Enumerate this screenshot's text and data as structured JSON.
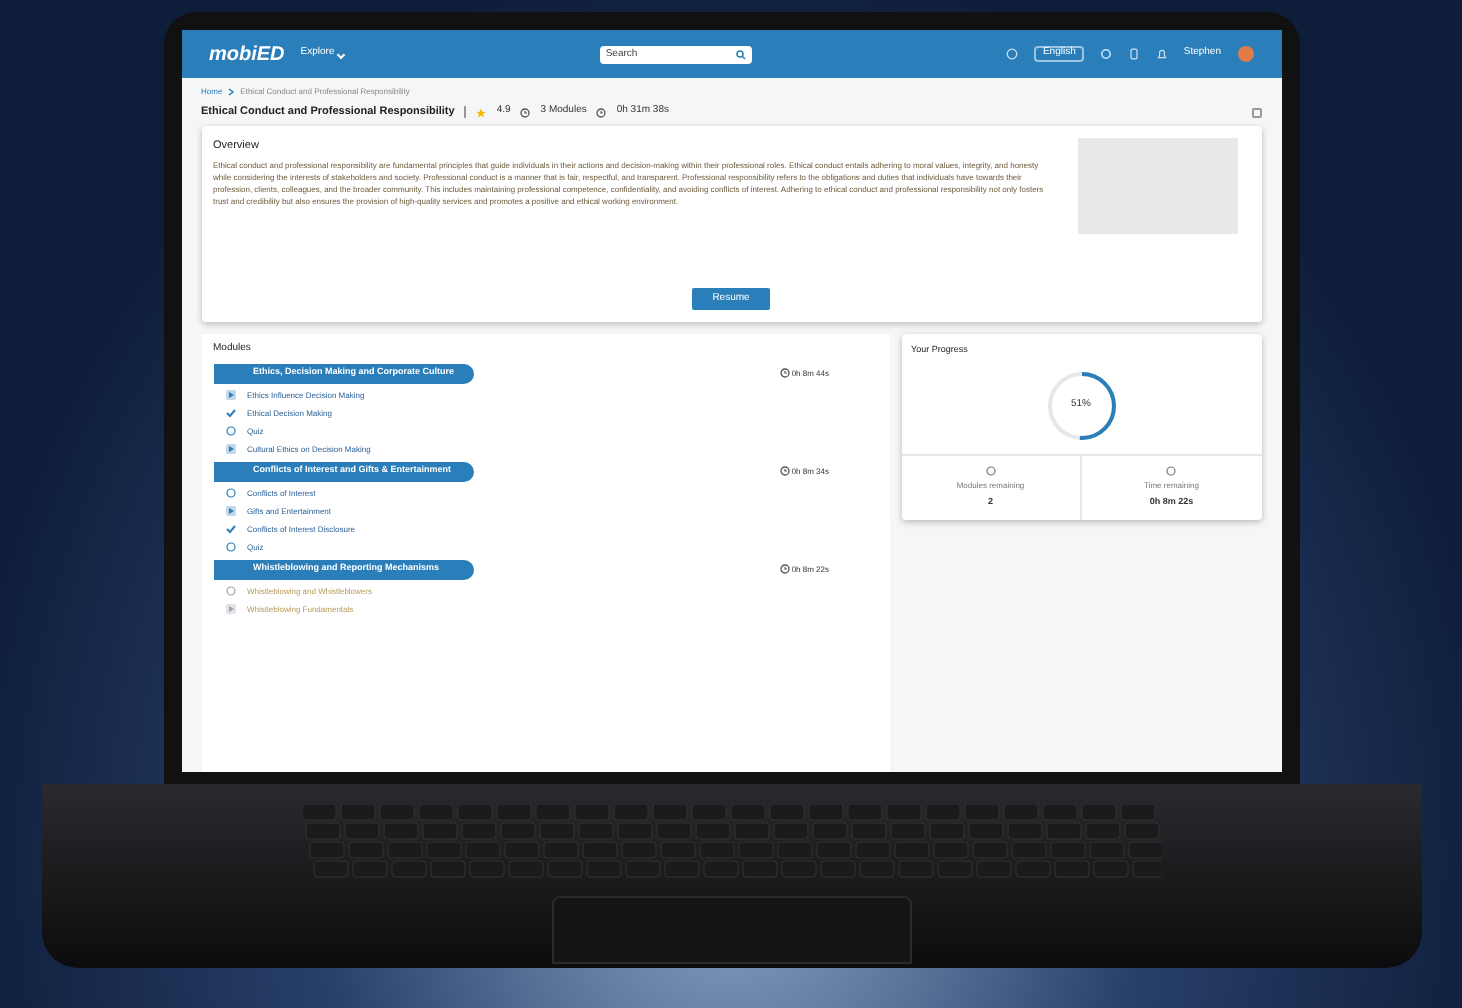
{
  "header": {
    "logo": "mobiED",
    "explore": "Explore",
    "search": {
      "placeholder": "Search"
    },
    "language": "English",
    "user": "Stephen"
  },
  "breadcrumb": [
    "Home",
    "Ethical Conduct and Professional Responsibility"
  ],
  "course": {
    "title": "Ethical Conduct and Professional Responsibility",
    "rating": "4.9",
    "modules": "3 Modules",
    "duration": "0h 31m 38s"
  },
  "overview": {
    "title": "Overview",
    "text": "Ethical conduct and professional responsibility are fundamental principles that guide individuals in their actions and decision-making within their professional roles. Ethical conduct entails adhering to moral values, integrity, and honesty while considering the interests of stakeholders and society. Professional conduct is a manner that is fair, respectful, and transparent. Professional responsibility refers to the obligations and duties that individuals have towards their profession, clients, colleagues, and the broader community. This includes maintaining professional competence, confidentiality, and avoiding conflicts of interest. Adhering to ethical conduct and professional responsibility not only fosters trust and credibility but also ensures the provision of high-quality services and promotes a positive and ethical working environment.",
    "button": "Resume"
  },
  "modules": {
    "title": "Modules",
    "items": [
      {
        "title": "Ethics, Decision Making and Corporate Culture",
        "time": "0h 8m 44s",
        "lessons": [
          {
            "kind": "video",
            "title": "Ethics Influence Decision Making",
            "done": true
          },
          {
            "kind": "check",
            "title": "Ethical Decision Making",
            "done": true
          },
          {
            "kind": "quiz",
            "title": "Quiz",
            "done": true
          },
          {
            "kind": "video",
            "title": "Cultural Ethics on Decision Making",
            "done": true
          }
        ]
      },
      {
        "title": "Conflicts of Interest and Gifts & Entertainment",
        "time": "0h 8m 34s",
        "lessons": [
          {
            "kind": "quiz",
            "title": "Conflicts of Interest",
            "done": true
          },
          {
            "kind": "video",
            "title": "Gifts and Entertainment",
            "done": true
          },
          {
            "kind": "check",
            "title": "Conflicts of Interest Disclosure",
            "done": true
          },
          {
            "kind": "quiz",
            "title": "Quiz",
            "done": true
          }
        ]
      },
      {
        "title": "Whistleblowing and Reporting Mechanisms",
        "time": "0h 8m 22s",
        "lessons": [
          {
            "kind": "quiz",
            "title": "Whistleblowing and Whistleblowers",
            "done": false
          },
          {
            "kind": "video",
            "title": "Whistleblowing Fundamentals",
            "done": false
          }
        ]
      }
    ]
  },
  "progress": {
    "title": "Your Progress",
    "percent": "51%",
    "level": 0.51,
    "stats": [
      {
        "label": "Modules remaining",
        "value": "2"
      },
      {
        "label": "Time remaining",
        "value": "0h 8m 22s"
      }
    ]
  }
}
